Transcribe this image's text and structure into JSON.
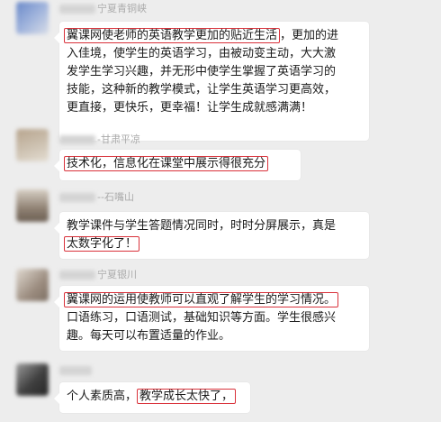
{
  "messages": [
    {
      "sender": "宁夏青铜峡",
      "avatar_colors": [
        "#6a89c9",
        "#d8dde8"
      ],
      "lines": [
        {
          "highlight": "翼课网使老师的英语教学更加的贴近生活",
          "text": "，更加的进"
        },
        {
          "highlight": "",
          "text": "入佳境，使学生的英语学习，由被动变主动，大大激"
        },
        {
          "highlight": "",
          "text": "发学生学习兴趣，并无形中使学生掌握了英语学习的"
        },
        {
          "highlight": "",
          "text": "技能，这种新的教学模式，让学生英语学习更高效，"
        },
        {
          "highlight": "",
          "text": "更直接，更快乐，更幸福！让学生成就感满满！"
        }
      ]
    },
    {
      "sender": "-甘肃平凉",
      "avatar_colors": [
        "#b7a48d",
        "#e4ddd2"
      ],
      "lines": [
        {
          "highlight": "技术化，信息化在课堂中展示得很充分",
          "text": ""
        }
      ]
    },
    {
      "sender": "--石嘴山",
      "avatar_colors": [
        "#8e8072",
        "#d7cfc4"
      ],
      "lines": [
        {
          "highlight": "",
          "text": "教学课件与学生答题情况同时，时时分屏展示，真是"
        },
        {
          "highlight": "太数字化了！",
          "text": ""
        }
      ]
    },
    {
      "sender": "宁夏银川",
      "avatar_colors": [
        "#9c8d80",
        "#e0d9d0"
      ],
      "lines": [
        {
          "highlight": "翼课网的运用使教师可以直观了解学生的学习情况。",
          "text": ""
        },
        {
          "highlight": "",
          "text": "口语练习，口语测试，基础知识等方面。学生很感兴"
        },
        {
          "highlight": "",
          "text": "趣。每天可以布置适量的作业。"
        }
      ]
    },
    {
      "sender": "",
      "avatar_colors": [
        "#3f3f3f",
        "#9a9a9a"
      ],
      "lines": [
        {
          "text": "个人素质高，",
          "highlight": "教学成长太快了，"
        }
      ]
    }
  ]
}
